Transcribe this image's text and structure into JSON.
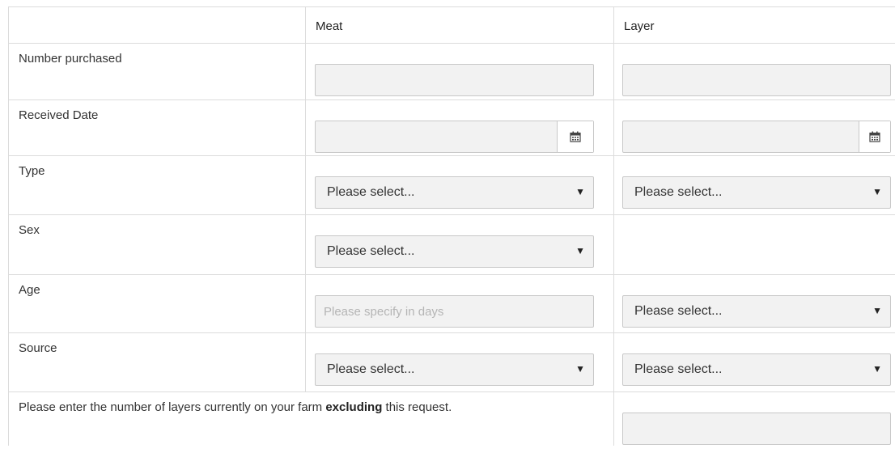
{
  "header": {
    "meat": "Meat",
    "layer": "Layer"
  },
  "rows": {
    "number_purchased": {
      "label": "Number purchased",
      "meat_value": "",
      "layer_value": ""
    },
    "received_date": {
      "label": "Received Date",
      "meat_value": "",
      "layer_value": "",
      "icon": "calendar-icon"
    },
    "type": {
      "label": "Type",
      "meat_select": "Please select...",
      "layer_select": "Please select..."
    },
    "sex": {
      "label": "Sex",
      "meat_select": "Please select..."
    },
    "age": {
      "label": "Age",
      "meat_placeholder": "Please specify in days",
      "layer_select": "Please select..."
    },
    "source": {
      "label": "Source",
      "meat_select": "Please select...",
      "layer_select": "Please select..."
    }
  },
  "layers_note": {
    "prefix": "Please enter the number of layers currently on your farm ",
    "emphasis": "excluding",
    "suffix": " this request.",
    "value": ""
  },
  "select_arrow": "▼"
}
